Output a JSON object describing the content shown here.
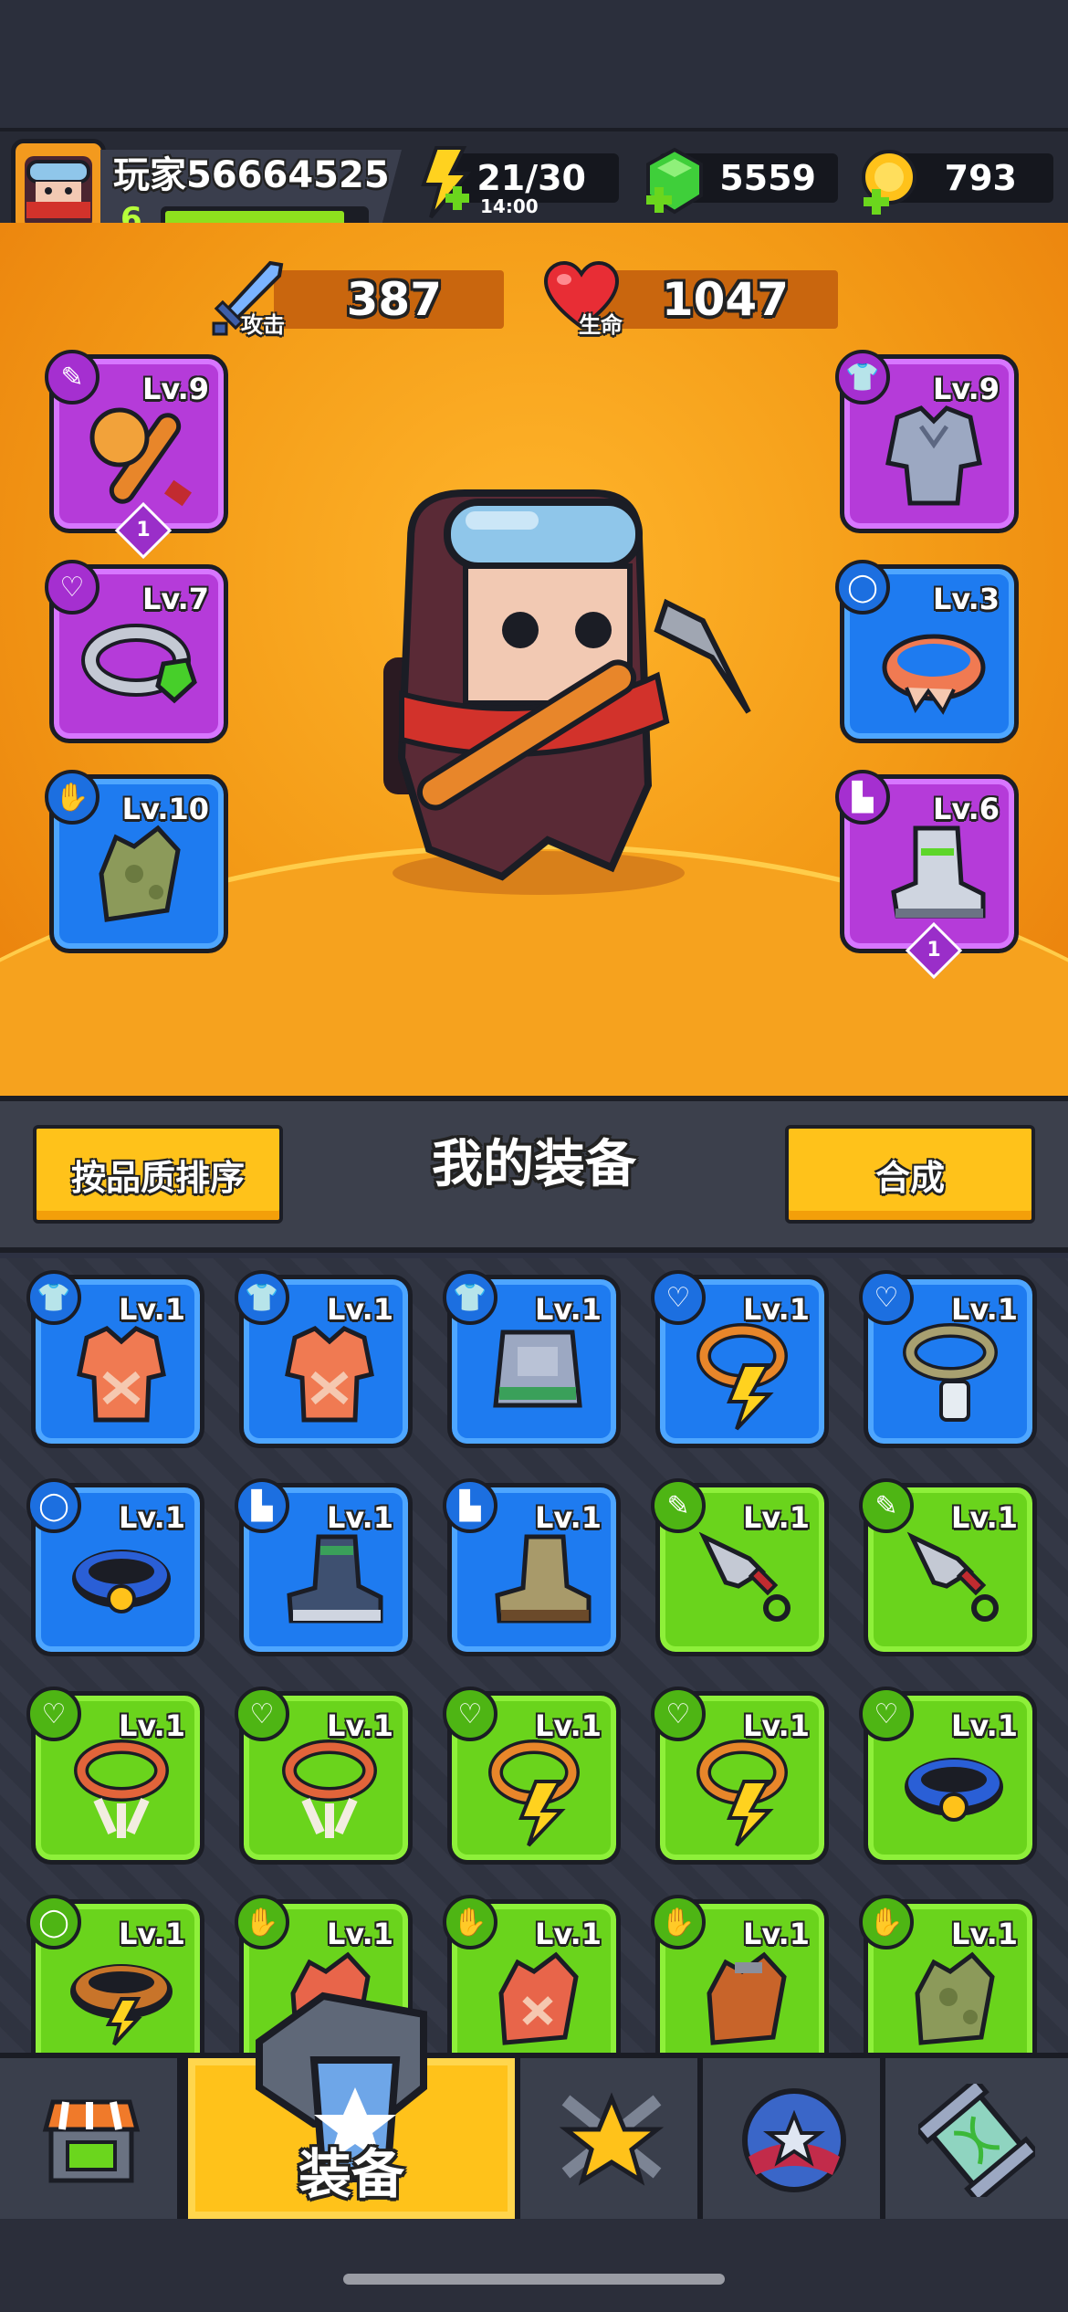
{
  "player": {
    "name": "玩家56664525",
    "level": "6",
    "xp_fraction": 0.9
  },
  "resources": {
    "energy": {
      "value": "21/30",
      "timer": "14:00"
    },
    "gems": {
      "value": "5559"
    },
    "coins": {
      "value": "793"
    }
  },
  "stats": {
    "attack": {
      "label": "攻击",
      "value": "387"
    },
    "hp": {
      "label": "生命",
      "value": "1047"
    }
  },
  "equipped": {
    "weapon": {
      "level": "Lv.9",
      "stack": "1"
    },
    "armor": {
      "level": "Lv.9"
    },
    "necklace": {
      "level": "Lv.7"
    },
    "belt": {
      "level": "Lv.3"
    },
    "gloves": {
      "level": "Lv.10"
    },
    "boots": {
      "level": "Lv.6",
      "stack": "1"
    }
  },
  "toolbar": {
    "sort_label": "按品质排序",
    "title": "我的装备",
    "merge_label": "合成"
  },
  "inventory": [
    {
      "level": "Lv.1",
      "rarity": "blue",
      "slot": "armor",
      "item": "red-vest-icon"
    },
    {
      "level": "Lv.1",
      "rarity": "blue",
      "slot": "armor",
      "item": "red-vest-icon"
    },
    {
      "level": "Lv.1",
      "rarity": "blue",
      "slot": "armor",
      "item": "steel-vest-icon"
    },
    {
      "level": "Lv.1",
      "rarity": "blue",
      "slot": "necklace",
      "item": "lightning-necklace-icon"
    },
    {
      "level": "Lv.1",
      "rarity": "blue",
      "slot": "necklace",
      "item": "dogtag-necklace-icon"
    },
    {
      "level": "Lv.1",
      "rarity": "blue",
      "slot": "belt",
      "item": "blue-belt-icon"
    },
    {
      "level": "Lv.1",
      "rarity": "blue",
      "slot": "boots",
      "item": "steel-boots-icon"
    },
    {
      "level": "Lv.1",
      "rarity": "blue",
      "slot": "boots",
      "item": "leather-boots-icon"
    },
    {
      "level": "Lv.1",
      "rarity": "green",
      "slot": "weapon",
      "item": "kunai-icon"
    },
    {
      "level": "Lv.1",
      "rarity": "green",
      "slot": "weapon",
      "item": "kunai-icon"
    },
    {
      "level": "Lv.1",
      "rarity": "green",
      "slot": "necklace",
      "item": "bone-necklace-icon"
    },
    {
      "level": "Lv.1",
      "rarity": "green",
      "slot": "necklace",
      "item": "bone-necklace-icon"
    },
    {
      "level": "Lv.1",
      "rarity": "green",
      "slot": "necklace",
      "item": "lightning-necklace-icon"
    },
    {
      "level": "Lv.1",
      "rarity": "green",
      "slot": "necklace",
      "item": "lightning-necklace-icon"
    },
    {
      "level": "Lv.1",
      "rarity": "green",
      "slot": "necklace",
      "item": "blue-belt-icon"
    },
    {
      "level": "Lv.1",
      "rarity": "green",
      "slot": "belt",
      "item": "lightning-belt-icon"
    },
    {
      "level": "Lv.1",
      "rarity": "green",
      "slot": "gloves",
      "item": "red-glove-icon"
    },
    {
      "level": "Lv.1",
      "rarity": "green",
      "slot": "gloves",
      "item": "red-glove-icon"
    },
    {
      "level": "Lv.1",
      "rarity": "green",
      "slot": "gloves",
      "item": "brown-glove-icon"
    },
    {
      "level": "Lv.1",
      "rarity": "green",
      "slot": "gloves",
      "item": "camo-glove-icon"
    }
  ],
  "nav": {
    "active_label": "装备",
    "tabs": [
      "shop-icon",
      "equipment-icon",
      "battle-icon",
      "talent-icon",
      "evolve-icon"
    ]
  },
  "colors": {
    "orange": "#f08a10",
    "blue_rarity": "#1e7bf0",
    "green_rarity": "#6ad41c",
    "purple_rarity": "#b53bd9",
    "button_yellow": "#ffc21a"
  }
}
